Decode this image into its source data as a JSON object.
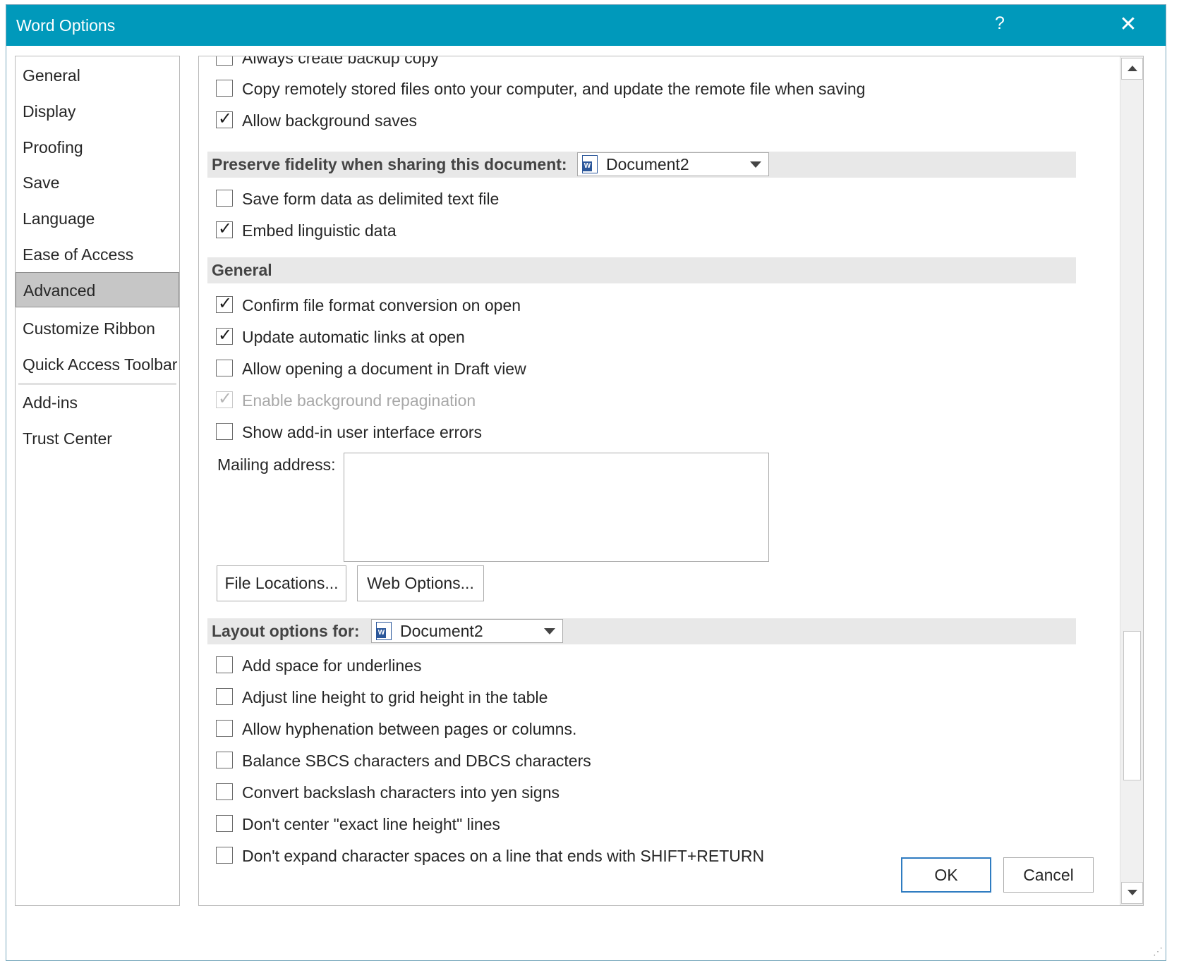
{
  "dialog": {
    "title": "Word Options",
    "help_label": "?",
    "close_label": "✕"
  },
  "nav": {
    "items": [
      {
        "label": "General"
      },
      {
        "label": "Display"
      },
      {
        "label": "Proofing"
      },
      {
        "label": "Save"
      },
      {
        "label": "Language"
      },
      {
        "label": "Ease of Access"
      },
      {
        "label": "Advanced",
        "selected": true
      },
      {
        "label": "Customize Ribbon"
      },
      {
        "label": "Quick Access Toolbar"
      },
      {
        "label": "Add-ins"
      },
      {
        "label": "Trust Center"
      }
    ]
  },
  "content": {
    "top_options": [
      {
        "label": "Always create backup copy",
        "checked": false
      },
      {
        "label": "Copy remotely stored files onto your computer, and update the remote file when saving",
        "checked": false
      },
      {
        "label": "Allow background saves",
        "checked": true
      }
    ],
    "preserve_fidelity": {
      "heading": "Preserve fidelity when sharing this document:",
      "document": "Document2",
      "options": [
        {
          "label": "Save form data as delimited text file",
          "checked": false
        },
        {
          "label": "Embed linguistic data",
          "checked": true
        }
      ]
    },
    "general": {
      "heading": "General",
      "options": [
        {
          "label": "Confirm file format conversion on open",
          "checked": true
        },
        {
          "label": "Update automatic links at open",
          "checked": true
        },
        {
          "label": "Allow opening a document in Draft view",
          "checked": false
        },
        {
          "label": "Enable background repagination",
          "checked": true,
          "disabled": true
        },
        {
          "label": "Show add-in user interface errors",
          "checked": false
        }
      ],
      "mailing_address_label": "Mailing address:",
      "mailing_address_value": "",
      "file_locations_button": "File Locations...",
      "web_options_button": "Web Options..."
    },
    "layout": {
      "heading": "Layout options for:",
      "document": "Document2",
      "options": [
        {
          "label": "Add space for underlines",
          "checked": false
        },
        {
          "label": "Adjust line height to grid height in the table",
          "checked": false
        },
        {
          "label": "Allow hyphenation between pages or columns.",
          "checked": false
        },
        {
          "label": "Balance SBCS characters and DBCS characters",
          "checked": false
        },
        {
          "label": "Convert backslash characters into yen signs",
          "checked": false
        },
        {
          "label": "Don't center \"exact line height\" lines",
          "checked": false
        },
        {
          "label": "Don't expand character spaces on a line that ends with SHIFT+RETURN",
          "checked": false
        }
      ]
    }
  },
  "footer": {
    "ok_label": "OK",
    "cancel_label": "Cancel"
  },
  "icons": {
    "checkmark": "✓",
    "document-icon": "word-document",
    "dropdown-arrow": "chevron-down",
    "scroll-up": "triangle-up",
    "scroll-down": "triangle-down"
  },
  "colors": {
    "titlebar": "#0099bb",
    "selected_nav": "#c6c6c6",
    "section_band": "#e8e8e8",
    "ok_border": "#2f7cc1"
  }
}
